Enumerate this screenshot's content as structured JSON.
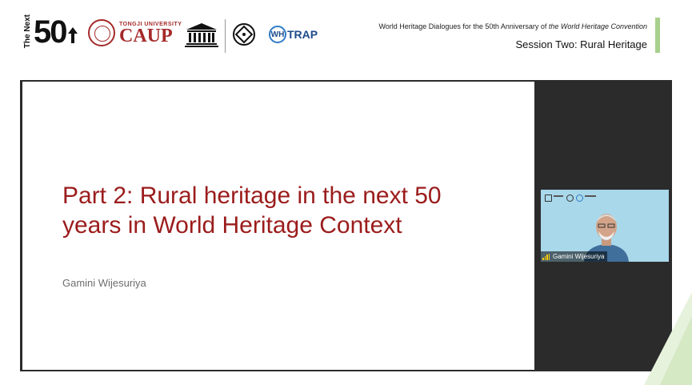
{
  "header": {
    "logo_next": "The Next",
    "logo_50": "50",
    "caup_small": "TONGJI UNIVERSITY",
    "caup_big": "CAUP",
    "unesco": "UNESCO",
    "whitrap": "WH",
    "whitrap_rest": "TRAP",
    "line1_pre": "World Heritage Dialogues for the 50th Anniversary of",
    "line1_italic": "the World Heritage Convention",
    "session": "Session Two: Rural Heritage"
  },
  "slide": {
    "title_line1": "Part 2: Rural heritage in the next 50",
    "title_line2": "years in World Heritage Context",
    "author": "Gamini Wijesuriya"
  },
  "participant": {
    "name": "Gamini Wijesuriya"
  },
  "colors": {
    "title_red": "#9b1c1c",
    "accent_green": "#a8d08d",
    "video_bg": "#a9d8ea"
  }
}
